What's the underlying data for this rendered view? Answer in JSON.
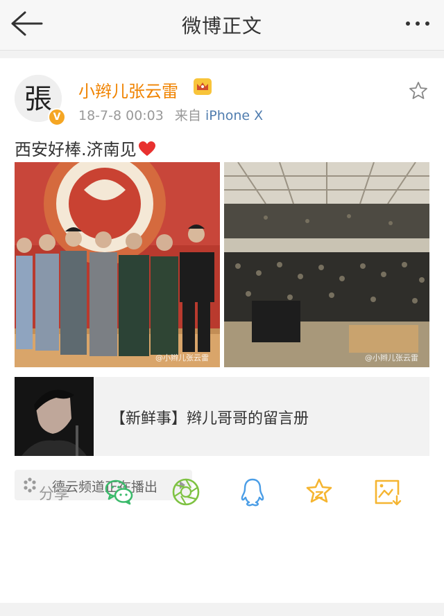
{
  "header": {
    "title": "微博正文",
    "back_icon": "arrow-left-icon",
    "more_icon": "more-dots-icon"
  },
  "post": {
    "user": "小辫儿张云雷",
    "avatar_text": "張",
    "verified_badge": "V",
    "time": "18-7-8 00:03",
    "source_prefix": "来自",
    "source": "iPhone X",
    "text": "西安好棒.济南见",
    "watermark": "@小辫儿张云雷"
  },
  "link_card": {
    "title": "【新鲜事】辫儿哥哥的留言册"
  },
  "channel": {
    "label": "德云频道正在播出"
  },
  "share": {
    "label": "分享"
  },
  "colors": {
    "username": "#f08300",
    "source": "#507daf",
    "share_icon": "#3bba6b",
    "star_icon": "#f5b531"
  }
}
